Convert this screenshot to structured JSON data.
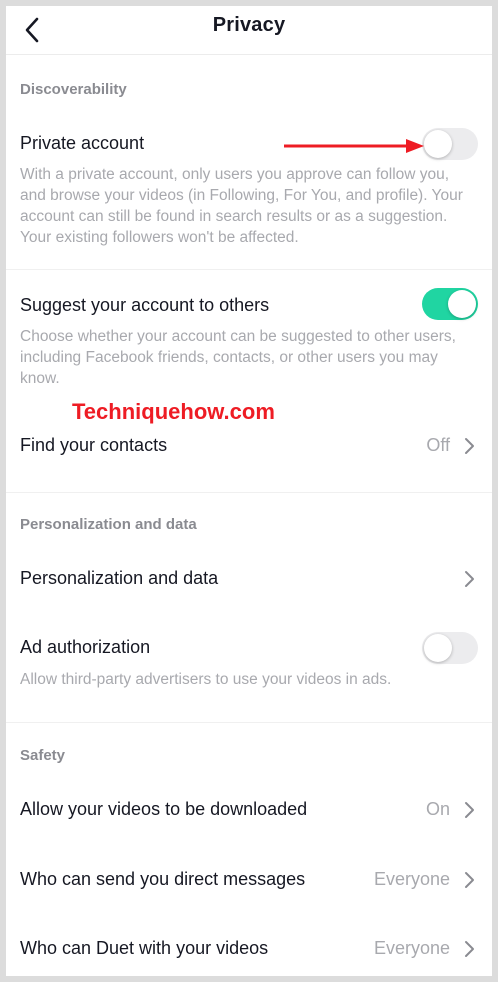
{
  "header": {
    "title": "Privacy"
  },
  "sections": {
    "discoverability": "Discoverability",
    "personalization": "Personalization and data",
    "safety": "Safety"
  },
  "private_account": {
    "label": "Private account",
    "state": "off",
    "description": "With a private account, only users you approve can follow you, and browse your videos (in Following, For You, and profile). Your account can still be found in search results or as a suggestion. Your existing followers won't be affected."
  },
  "suggest_account": {
    "label": "Suggest your account to others",
    "state": "on",
    "description": "Choose whether your account can be suggested to other users, including Facebook friends, contacts, or other users you may know."
  },
  "watermark": "Techniquehow.com",
  "find_contacts": {
    "label": "Find your contacts",
    "value": "Off"
  },
  "personalization_data": {
    "label": "Personalization and data"
  },
  "ad_authorization": {
    "label": "Ad authorization",
    "state": "off",
    "description": "Allow third-party advertisers to use your videos in ads."
  },
  "allow_download": {
    "label": "Allow your videos to be downloaded",
    "value": "On"
  },
  "direct_messages": {
    "label": "Who can send you direct messages",
    "value": "Everyone"
  },
  "duet": {
    "label": "Who can Duet with your videos",
    "value": "Everyone"
  },
  "colors": {
    "accent_toggle_on": "#20d5a2",
    "annotation_red": "#ee1c24",
    "secondary_text": "#a8a9ae"
  }
}
